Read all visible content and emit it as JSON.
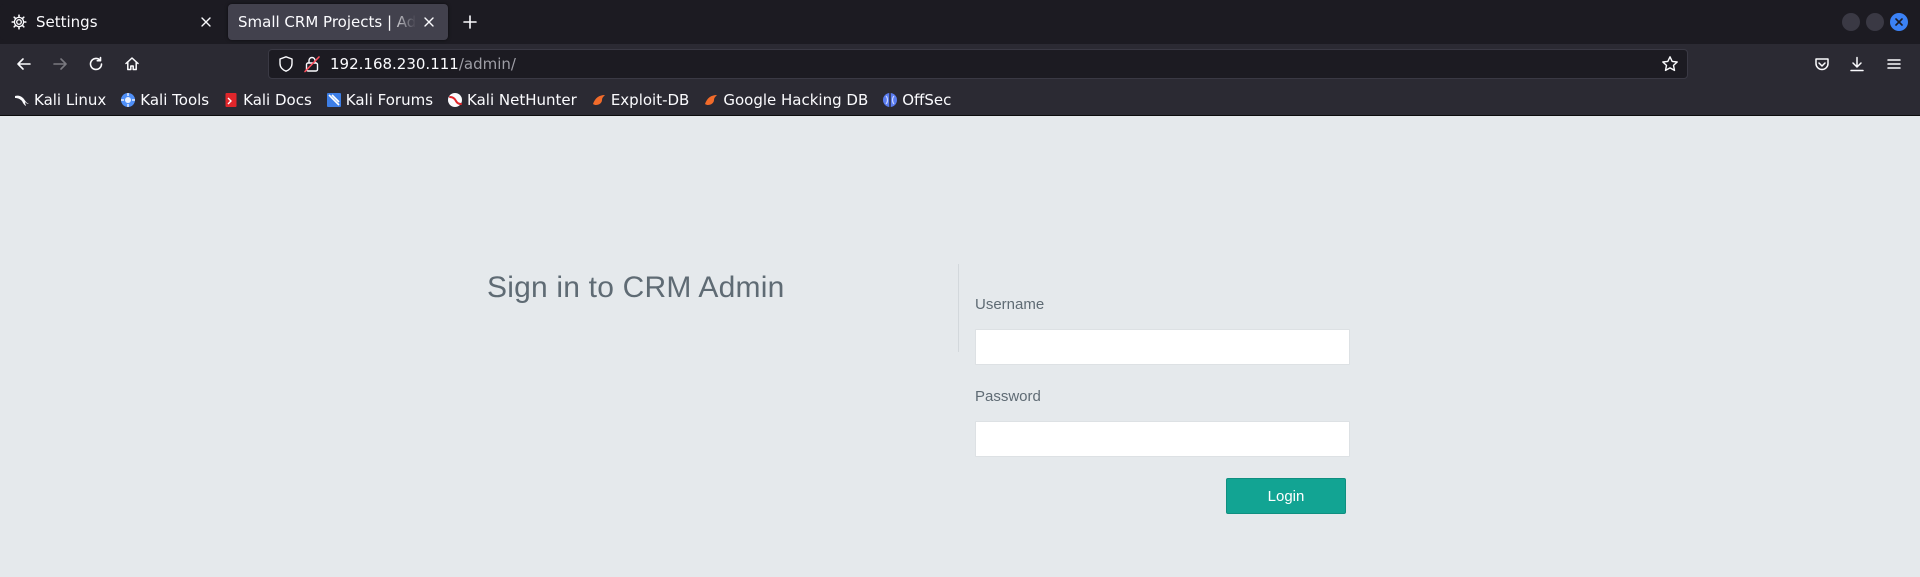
{
  "tabs": [
    {
      "title": "Settings",
      "icon": "gear-icon"
    },
    {
      "title": "Small CRM Projects | Admin Login",
      "icon": ""
    }
  ],
  "address_bar": {
    "host": "192.168.230.111",
    "path": "/admin/"
  },
  "bookmarks": [
    {
      "label": "Kali Linux",
      "icon": "kali-dragon-icon",
      "color": "#ffffff"
    },
    {
      "label": "Kali Tools",
      "icon": "kali-tools-icon",
      "color": "#4f8ff7"
    },
    {
      "label": "Kali Docs",
      "icon": "kali-docs-icon",
      "color": "#e0262b"
    },
    {
      "label": "Kali Forums",
      "icon": "kali-forums-icon",
      "color": "#3d7ee6"
    },
    {
      "label": "Kali NetHunter",
      "icon": "nethunter-icon",
      "color": "#e0262b"
    },
    {
      "label": "Exploit-DB",
      "icon": "exploit-db-icon",
      "color": "#f26b2a"
    },
    {
      "label": "Google Hacking DB",
      "icon": "ghdb-icon",
      "color": "#f26b2a"
    },
    {
      "label": "OffSec",
      "icon": "offsec-icon",
      "color": "#5a7cf0"
    }
  ],
  "page": {
    "title": "Sign in to CRM Admin",
    "username_label": "Username",
    "username_value": "",
    "password_label": "Password",
    "password_value": "",
    "login_label": "Login"
  },
  "colors": {
    "accent": "#12a493",
    "page_bg": "#e5e9ec",
    "chrome_bg": "#2b2a33"
  }
}
